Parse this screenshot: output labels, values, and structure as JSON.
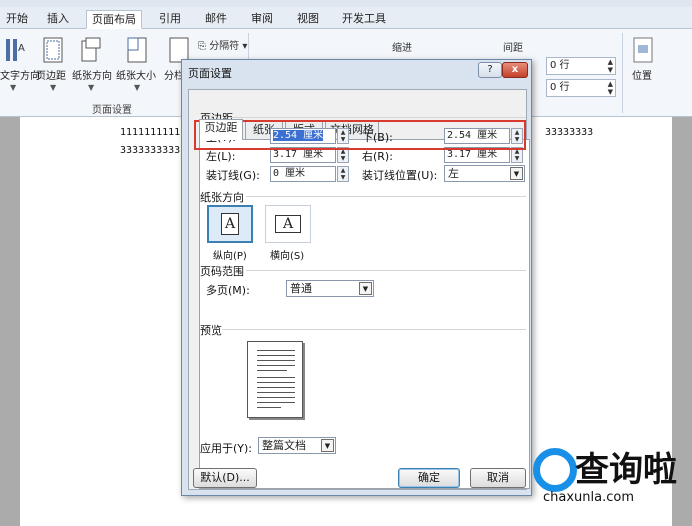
{
  "window_title": "",
  "ribbon_tabs": [
    "开始",
    "插入",
    "页面布局",
    "引用",
    "邮件",
    "审阅",
    "视图",
    "开发工具"
  ],
  "active_tab": "页面布局",
  "ribbon": {
    "buttons": [
      "文字方向",
      "页边距",
      "纸张方向",
      "纸张大小",
      "分栏"
    ],
    "separators_label": "分隔符",
    "group_label": "页面设置",
    "indent_label": "缩进",
    "spacing_label": "间距",
    "spacing_before": "0 行",
    "spacing_after": "0 行",
    "position_label": "位置"
  },
  "document": {
    "line1": "1111111111",
    "line1_right": "33333333",
    "line2": "3333333333"
  },
  "dialog": {
    "title": "页面设置",
    "help": "?",
    "close": "x",
    "tabs": [
      "页边距",
      "纸张",
      "版式",
      "文档网格"
    ],
    "active_tab": "页边距",
    "margins_section": "页边距",
    "top_label": "上(T):",
    "top_value": "2.54 厘米",
    "bottom_label": "下(B):",
    "bottom_value": "2.54 厘米",
    "left_label": "左(L):",
    "left_value": "3.17 厘米",
    "right_label": "右(R):",
    "right_value": "3.17 厘米",
    "gutter_label": "装订线(G):",
    "gutter_value": "0 厘米",
    "gutter_pos_label": "装订线位置(U):",
    "gutter_pos_value": "左",
    "orientation_section": "纸张方向",
    "portrait_label": "纵向(P)",
    "landscape_label": "横向(S)",
    "orient_glyph": "A",
    "pages_section": "页码范围",
    "multiple_pages_label": "多页(M):",
    "multiple_pages_value": "普通",
    "preview_section": "预览",
    "apply_to_label": "应用于(Y):",
    "apply_to_value": "整篇文档",
    "default_button": "默认(D)...",
    "ok_button": "确定",
    "cancel_button": "取消"
  },
  "watermark": {
    "text": "查询啦",
    "url": "chaxunla.com"
  },
  "colors": {
    "highlight_box": "#d93a2e",
    "selection": "#3b6fd0",
    "watermark_blue": "#1890e8"
  }
}
